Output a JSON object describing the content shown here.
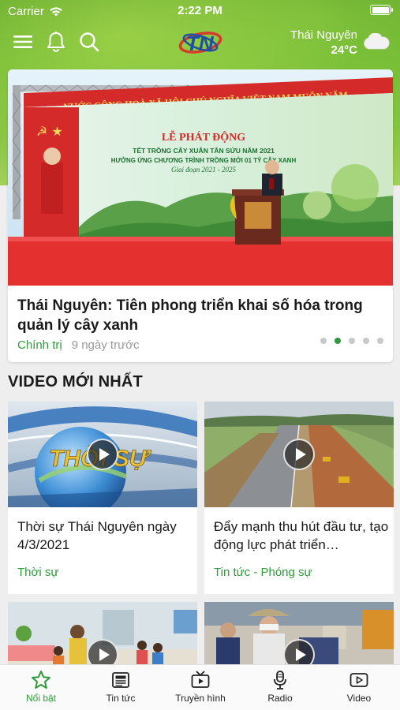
{
  "status_bar": {
    "carrier": "Carrier",
    "time": "2:22 PM"
  },
  "header": {
    "logo_text": "TN",
    "location": "Thái Nguyên",
    "temperature": "24°C",
    "weather_icon": "cloud-icon"
  },
  "featured": {
    "banner_top": "NƯỚC CỘNG HOÀ XÃ HỘI CHỦ NGHĨA VIỆT NAM MUÔN NĂM",
    "banner_heading": "LỄ PHÁT ĐỘNG",
    "banner_line1": "TẾT TRỒNG CÂY XUÂN TÂN SỬU NĂM 2021",
    "banner_line2": "HƯỞNG ỨNG CHƯƠNG TRÌNH TRỒNG MỚI 01 TỶ CÂY XANH",
    "banner_line3": "Giai đoạn 2021 - 2025",
    "title": "Thái Nguyên: Tiên phong triển khai số hóa trong quản lý cây xanh",
    "category": "Chính trị",
    "time_ago": "9 ngày trước",
    "carousel_total": 5,
    "carousel_active": 2
  },
  "videos_section": {
    "title": "VIDEO MỚI NHẤT",
    "items": [
      {
        "title": "Thời sự Thái Nguyên ngày 4/3/2021",
        "category": "Thời sự",
        "thumb_text": "THỜI SỰ"
      },
      {
        "title": "Đẩy mạnh thu hút đầu tư, tạo động lực phát triển…",
        "category": "Tin tức - Phóng sự"
      },
      {
        "title": "",
        "category": ""
      },
      {
        "title": "",
        "category": ""
      }
    ]
  },
  "tab_bar": {
    "items": [
      {
        "label": "Nổi bật",
        "icon": "star-icon",
        "active": true
      },
      {
        "label": "Tin tức",
        "icon": "newspaper-icon",
        "active": false
      },
      {
        "label": "Truyền hình",
        "icon": "tv-icon",
        "active": false
      },
      {
        "label": "Radio",
        "icon": "microphone-icon",
        "active": false
      },
      {
        "label": "Video",
        "icon": "video-play-icon",
        "active": false
      }
    ]
  },
  "colors": {
    "accent": "#2f9a3a",
    "header_green": "#6fb832",
    "muted": "#999999"
  }
}
